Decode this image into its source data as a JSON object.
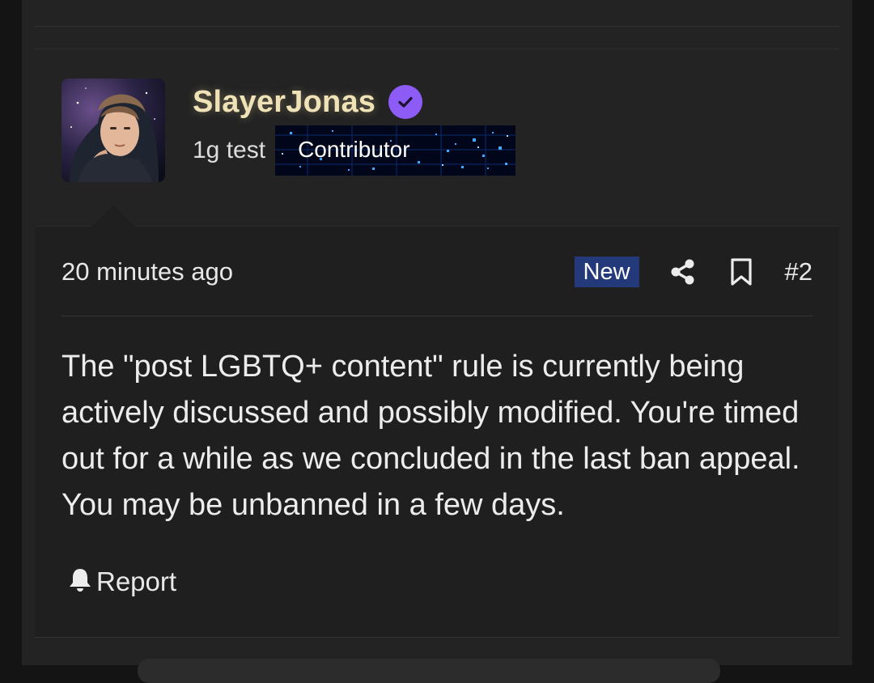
{
  "post": {
    "author": {
      "username": "SlayerJonas",
      "user_title": "1g test",
      "banner_label": "Contributor",
      "verified": true,
      "avatar_icon": "avatar-photo"
    },
    "time_ago": "20 minutes ago",
    "badge": "New",
    "post_number": "#2",
    "content": "The \"post LGBTQ+ content\" rule is currently being actively discussed and possibly modified. You're timed out for a while as we concluded in the last ban appeal. You may be unbanned in a few days.",
    "report_label": "Report",
    "icons": {
      "verified": "verified-check-icon",
      "share": "share-icon",
      "bookmark": "bookmark-icon",
      "report": "bell-icon"
    }
  },
  "colors": {
    "username": "#efe2b6",
    "verified_badge": "#8d5cf6",
    "new_badge": "#24397a",
    "background": "#1f1f1f"
  }
}
